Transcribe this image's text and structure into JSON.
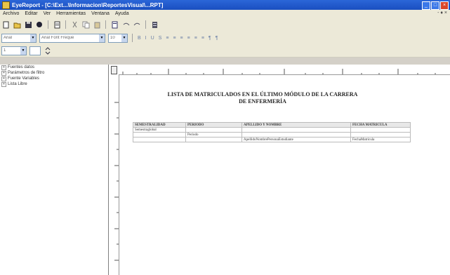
{
  "window": {
    "title": "EyeReport - [C:\\Ext...\\Informacion\\ReportesVisual\\...RPT]",
    "controls": [
      "_",
      "□",
      "×"
    ]
  },
  "menubar": {
    "items": [
      "Archivo",
      "Editar",
      "Ver",
      "Herramientas",
      "Ventana",
      "Ayuda"
    ],
    "close": "- ♦ ×"
  },
  "toolbar2": {
    "font_combo": "Arial",
    "style_combo": "Arial Font Freque",
    "size_combo": "10",
    "format_buttons": [
      "B",
      "I",
      "U",
      "S",
      "≡",
      "≡",
      "≡",
      "≡",
      "≡",
      "≡",
      "¶",
      "¶"
    ]
  },
  "toolbar3": {
    "zoom_combo": "1"
  },
  "tree": {
    "items": [
      "Fuentes datos",
      "Parámetros de filtro",
      "Fuente Variables",
      "Lista Libre"
    ]
  },
  "report": {
    "title_line1": "LISTA DE MATRICULADOS EN EL ÚLTIMO MÓDULO DE LA CARRERA",
    "title_line2": "DE ENFERMERÍA",
    "columns": [
      "SEMESTRALIDAD",
      "PERIODO",
      "APELLIDO Y NOMBRE",
      "FECHA MATRICULA"
    ],
    "rows": [
      [
        "Semestraglobal",
        "",
        "",
        ""
      ],
      [
        "",
        "Periodo",
        "",
        ""
      ],
      [
        "",
        "",
        "ApellidoNombrePersonaEstudiante",
        "FechaMatricula"
      ]
    ]
  }
}
